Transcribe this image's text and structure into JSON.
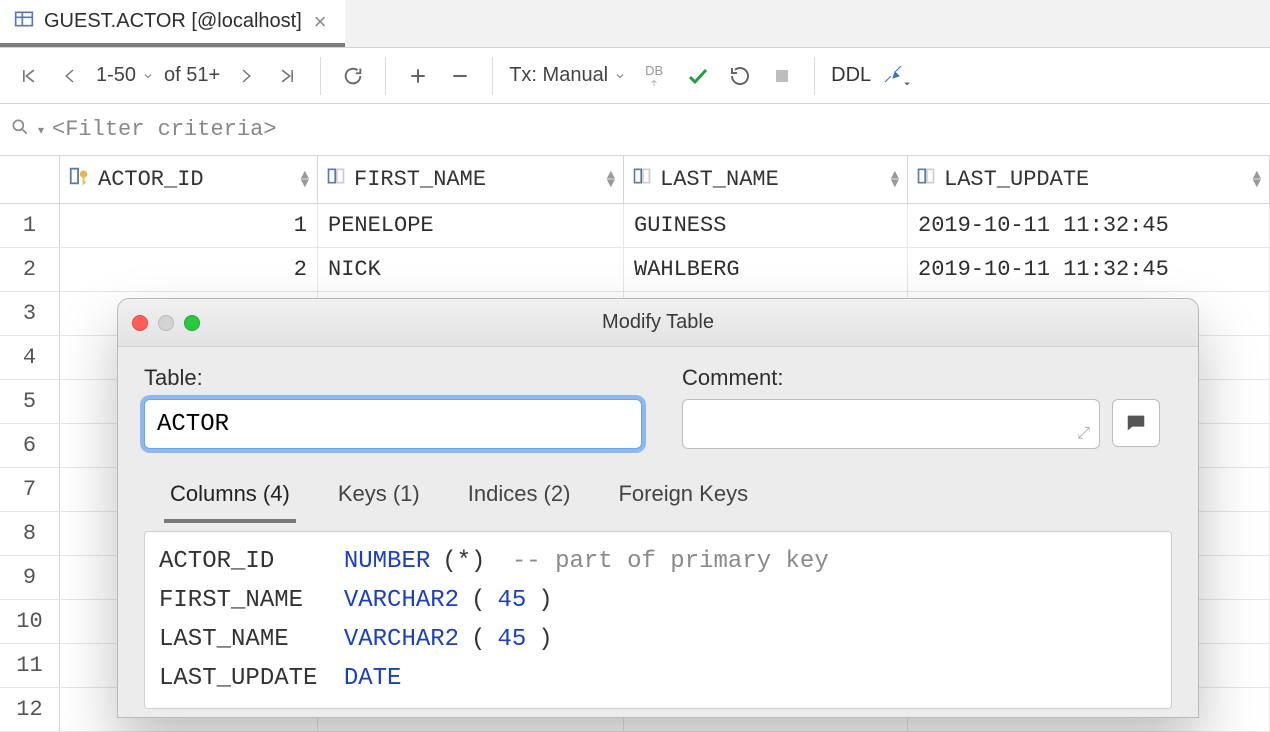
{
  "tab": {
    "title": "GUEST.ACTOR [@localhost]"
  },
  "toolbar": {
    "range": "1-50",
    "of_label": "of 51+",
    "tx_label": "Tx: Manual",
    "db_label": "DB",
    "ddl_label": "DDL"
  },
  "filter": {
    "placeholder": "<Filter criteria>"
  },
  "columns": [
    "ACTOR_ID",
    "FIRST_NAME",
    "LAST_NAME",
    "LAST_UPDATE"
  ],
  "rows": [
    {
      "n": "1",
      "ACTOR_ID": "1",
      "FIRST_NAME": "PENELOPE",
      "LAST_NAME": "GUINESS",
      "LAST_UPDATE": "2019-10-11 11:32:45"
    },
    {
      "n": "2",
      "ACTOR_ID": "2",
      "FIRST_NAME": "NICK",
      "LAST_NAME": "WAHLBERG",
      "LAST_UPDATE": "2019-10-11 11:32:45"
    },
    {
      "n": "3"
    },
    {
      "n": "4"
    },
    {
      "n": "5"
    },
    {
      "n": "6"
    },
    {
      "n": "7"
    },
    {
      "n": "8"
    },
    {
      "n": "9"
    },
    {
      "n": "10"
    },
    {
      "n": "11"
    },
    {
      "n": "12"
    }
  ],
  "dialog": {
    "title": "Modify Table",
    "table_label": "Table:",
    "table_value": "ACTOR",
    "comment_label": "Comment:",
    "comment_value": "",
    "tabs": {
      "columns": "Columns (4)",
      "keys": "Keys (1)",
      "indices": "Indices (2)",
      "fks": "Foreign Keys"
    },
    "schema": [
      {
        "name": "ACTOR_ID",
        "type_kw": "NUMBER",
        "args": "(*)",
        "comment": "-- part of primary key"
      },
      {
        "name": "FIRST_NAME",
        "type_kw": "VARCHAR2",
        "args_open": "(",
        "args_num": "45",
        "args_close": ")"
      },
      {
        "name": "LAST_NAME",
        "type_kw": "VARCHAR2",
        "args_open": "(",
        "args_num": "45",
        "args_close": ")"
      },
      {
        "name": "LAST_UPDATE",
        "type_kw": "DATE"
      }
    ]
  }
}
